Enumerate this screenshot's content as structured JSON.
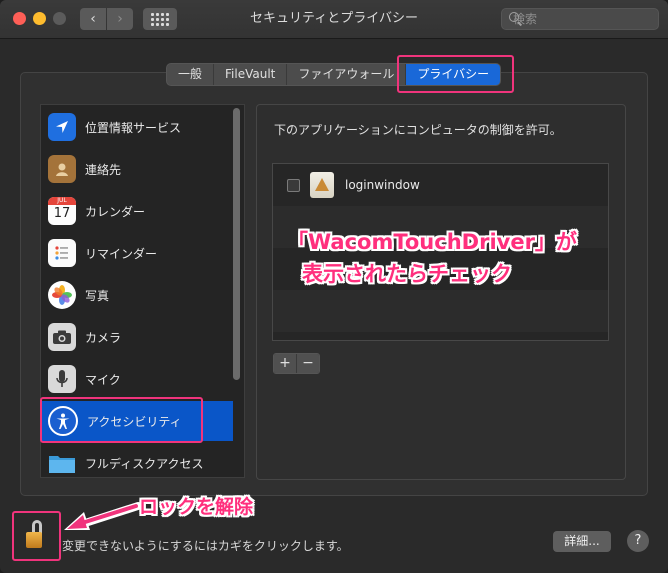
{
  "window": {
    "title": "セキュリティとプライバシー"
  },
  "toolbar": {
    "back_glyph": "‹",
    "forward_glyph": "›"
  },
  "search": {
    "placeholder": "検索"
  },
  "tabs": [
    {
      "label": "一般",
      "active": false
    },
    {
      "label": "FileVault",
      "active": false
    },
    {
      "label": "ファイアウォール",
      "active": false
    },
    {
      "label": "プライバシー",
      "active": true
    }
  ],
  "sidebar": {
    "items": [
      {
        "label": "位置情報サービス",
        "icon": "location-arrow-icon",
        "selected": false
      },
      {
        "label": "連絡先",
        "icon": "contacts-book-icon",
        "selected": false
      },
      {
        "label": "カレンダー",
        "icon": "calendar-icon",
        "selected": false,
        "icon_month": "JUL",
        "icon_day": "17"
      },
      {
        "label": "リマインダー",
        "icon": "reminders-list-icon",
        "selected": false
      },
      {
        "label": "写真",
        "icon": "photos-flower-icon",
        "selected": false
      },
      {
        "label": "カメラ",
        "icon": "camera-icon",
        "selected": false
      },
      {
        "label": "マイク",
        "icon": "microphone-icon",
        "selected": false
      },
      {
        "label": "アクセシビリティ",
        "icon": "accessibility-icon",
        "selected": true
      },
      {
        "label": "フルディスクアクセス",
        "icon": "folder-icon",
        "selected": false
      }
    ]
  },
  "main": {
    "description": "下のアプリケーションにコンピュータの制御を許可。",
    "apps": [
      {
        "name": "loginwindow",
        "checked": false
      }
    ],
    "add_label": "+",
    "remove_label": "−"
  },
  "footer": {
    "lock_text": "変更できないようにするにはカギをクリックします。",
    "details_label": "詳細...",
    "help_label": "?"
  },
  "annotations": {
    "check_note_line1": "「WacomTouchDriver」が",
    "check_note_line2": "表示されたらチェック",
    "lock_note": "ロックを解除",
    "highlight_color": "#f0347c"
  }
}
